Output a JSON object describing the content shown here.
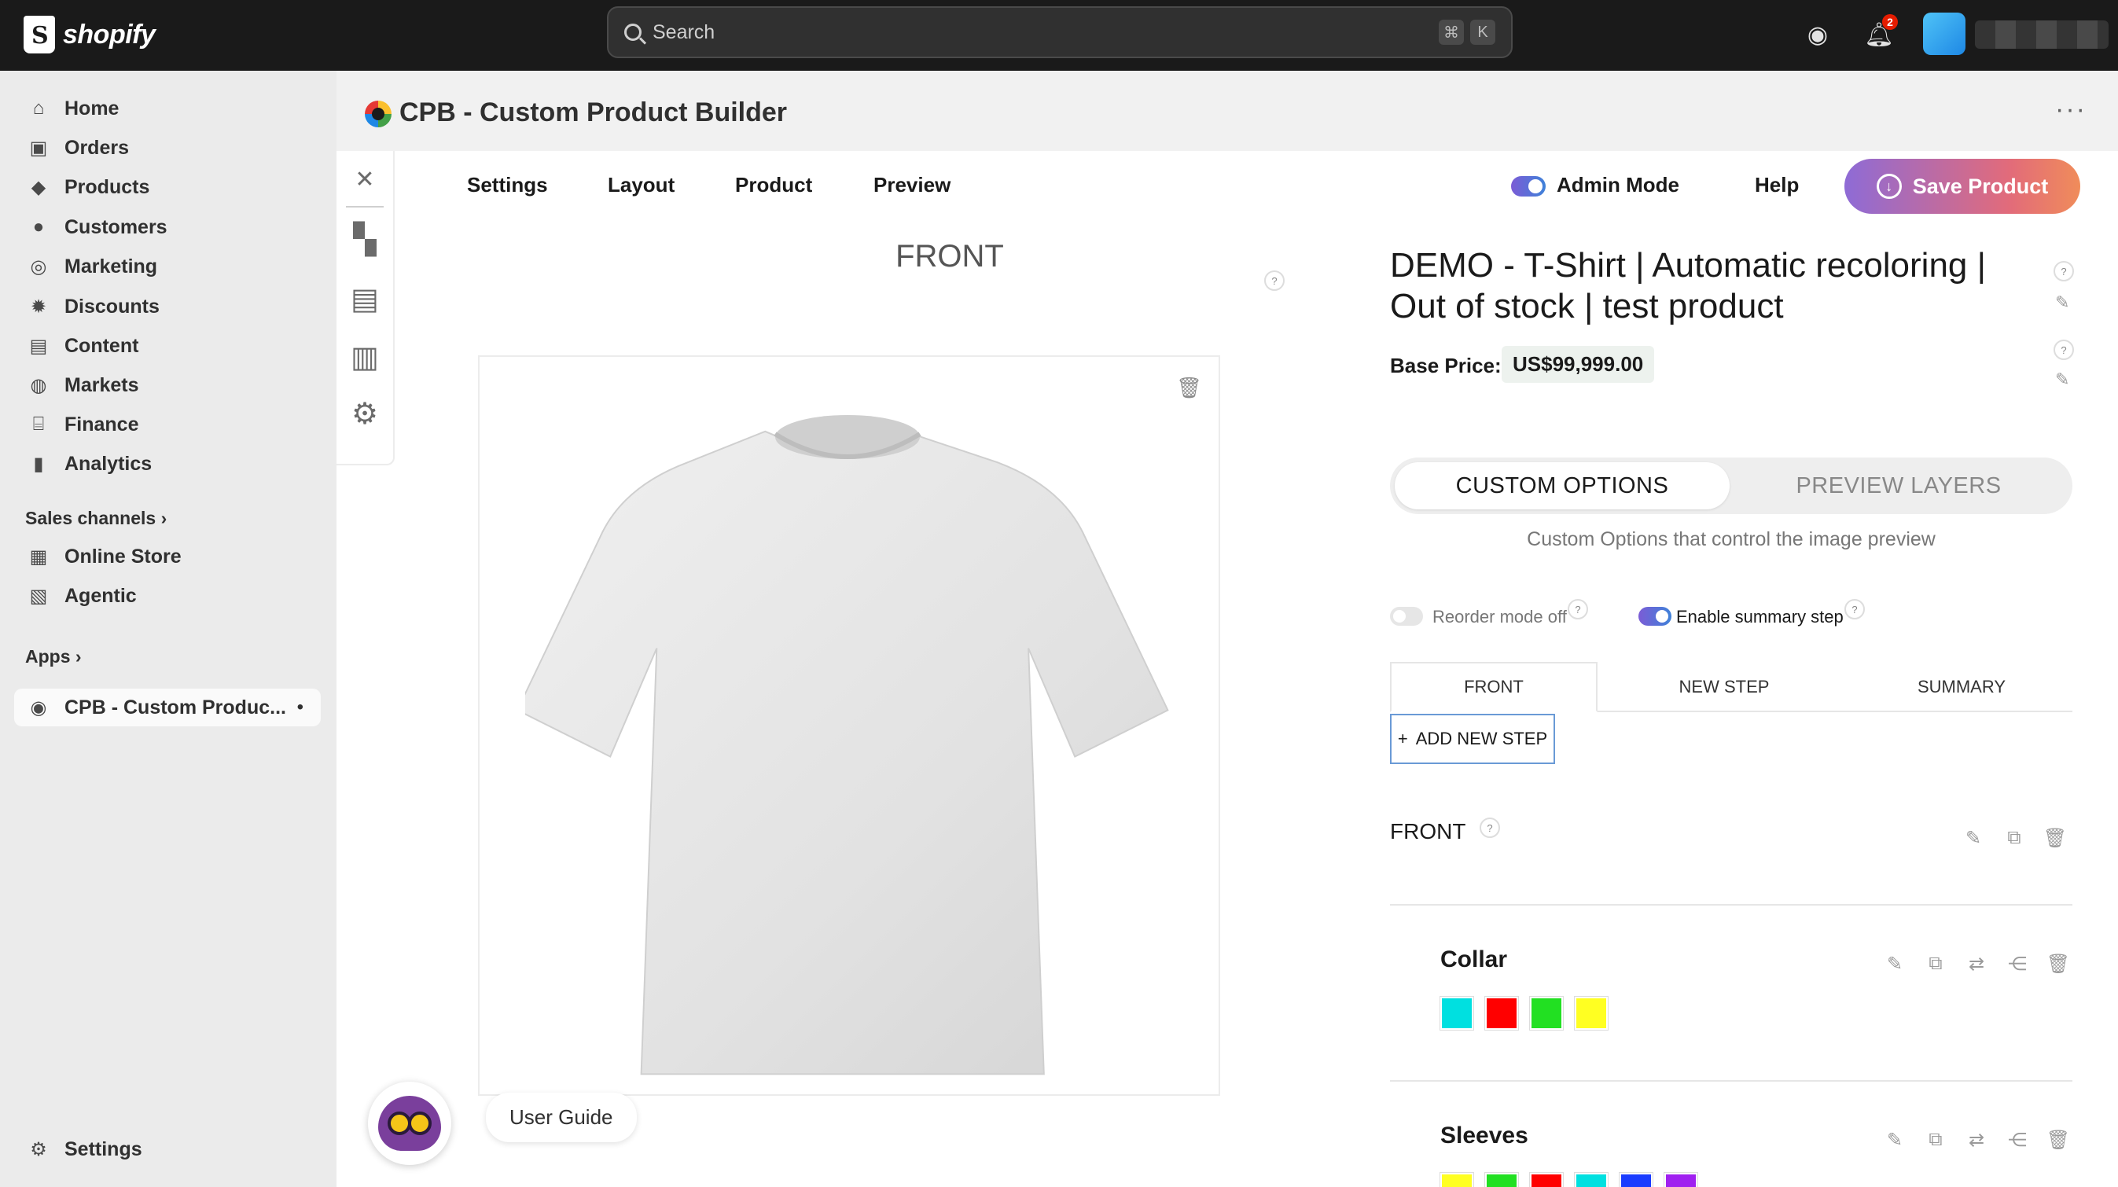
{
  "topbar": {
    "brand": "shopify",
    "search_placeholder": "Search",
    "shortcut_keys": [
      "⌘",
      "K"
    ],
    "notification_count": "2"
  },
  "sidebar": {
    "items": [
      {
        "label": "Home",
        "icon": "home-icon"
      },
      {
        "label": "Orders",
        "icon": "orders-icon"
      },
      {
        "label": "Products",
        "icon": "tag-icon"
      },
      {
        "label": "Customers",
        "icon": "person-icon"
      },
      {
        "label": "Marketing",
        "icon": "target-icon"
      },
      {
        "label": "Discounts",
        "icon": "discount-icon"
      },
      {
        "label": "Content",
        "icon": "image-icon"
      },
      {
        "label": "Markets",
        "icon": "globe-icon"
      },
      {
        "label": "Finance",
        "icon": "bank-icon"
      },
      {
        "label": "Analytics",
        "icon": "bar-chart-icon"
      }
    ],
    "sales_channels_label": "Sales channels",
    "channels": [
      {
        "label": "Online Store",
        "icon": "store-icon"
      },
      {
        "label": "Agentic",
        "icon": "agentic-icon"
      }
    ],
    "apps_label": "Apps",
    "active_app": "CPB - Custom Produc...",
    "settings_label": "Settings"
  },
  "app": {
    "title": "CPB - Custom Product Builder",
    "tabs": [
      "Settings",
      "Layout",
      "Product",
      "Preview"
    ],
    "admin_mode_label": "Admin Mode",
    "admin_mode_on": true,
    "help_label": "Help",
    "save_label": "Save Product"
  },
  "preview": {
    "view_title": "FRONT",
    "user_guide_label": "User Guide"
  },
  "product": {
    "title_line1": "DEMO - T-Shirt | Automatic recoloring |",
    "title_line2": "Out of stock | test product",
    "base_price_label": "Base Price:",
    "base_price_value": "US$99,999.00",
    "segments": [
      "CUSTOM OPTIONS",
      "PREVIEW LAYERS"
    ],
    "segment_subtitle": "Custom Options that control the image preview",
    "reorder_label": "Reorder mode off",
    "summary_label": "Enable summary step",
    "step_tabs": [
      "FRONT",
      "NEW STEP",
      "SUMMARY"
    ],
    "add_step_label": "ADD NEW STEP",
    "step_section_title": "FRONT",
    "options": [
      {
        "name": "Collar",
        "swatches": [
          "#00e0e0",
          "#ff0000",
          "#22e022",
          "#ffff22"
        ]
      },
      {
        "name": "Sleeves",
        "swatches": [
          "#ffff22",
          "#22e022",
          "#ff0000",
          "#00e0e0",
          "#1a3cff",
          "#a020f0"
        ]
      }
    ]
  },
  "colors": {
    "topbar_bg": "#1a1a1a",
    "sidebar_bg": "#ebebeb",
    "accent_purple": "#7b5cd6",
    "save_gradient_end": "#f08c5a"
  }
}
